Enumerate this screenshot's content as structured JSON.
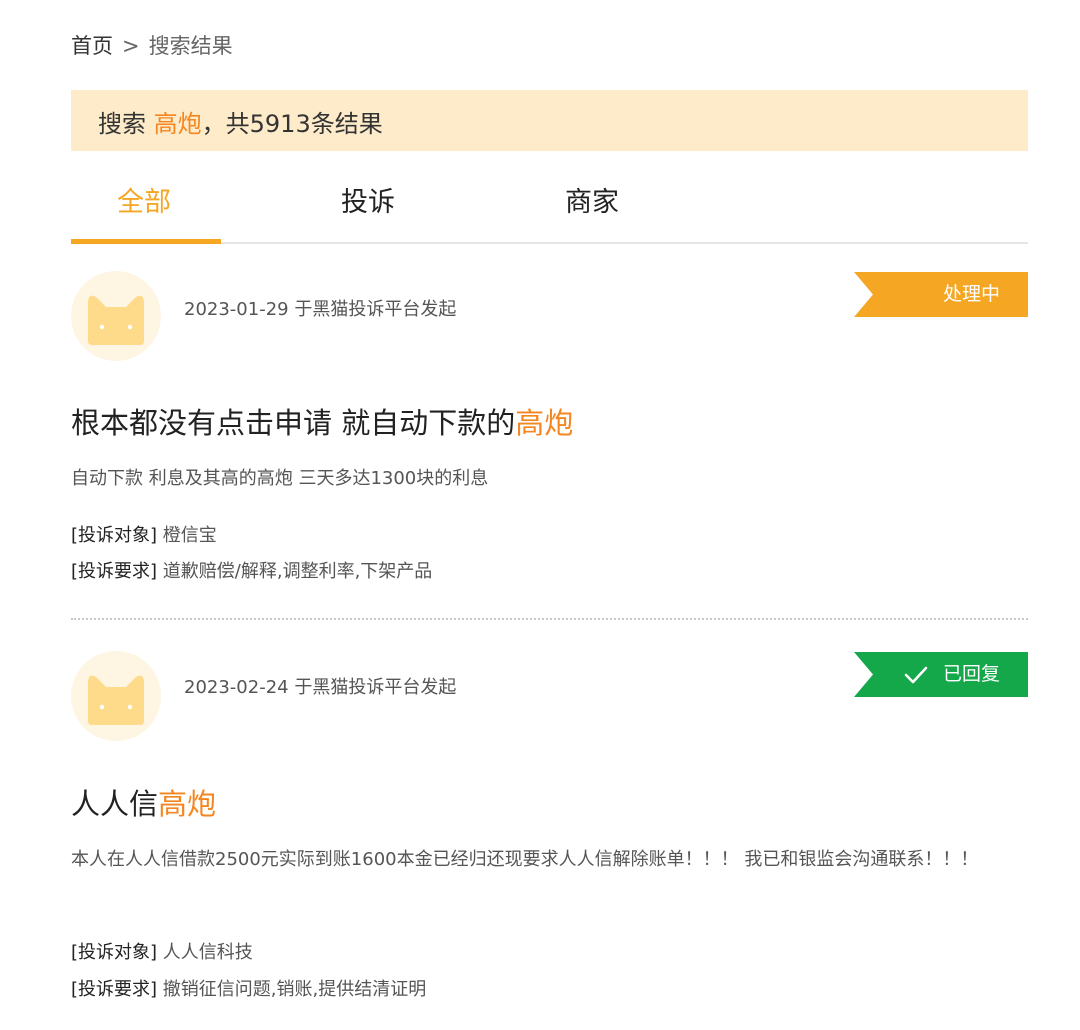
{
  "breadcrumb": {
    "home": "首页",
    "separator": ">",
    "current": "搜索结果"
  },
  "search": {
    "prefix": "搜索",
    "keyword": "高炮",
    "suffix": "，共5913条结果"
  },
  "tabs": [
    {
      "label": "全部",
      "active": true
    },
    {
      "label": "投诉",
      "active": false
    },
    {
      "label": "商家",
      "active": false
    }
  ],
  "results": [
    {
      "meta": "2023-01-29 于黑猫投诉平台发起",
      "status": {
        "label": "处理中",
        "color": "#f5a623",
        "icon": ""
      },
      "title_plain": "根本都没有点击申请 就自动下款的",
      "title_keyword": "高炮",
      "description": "自动下款 利息及其高的高炮 三天多达1300块的利息",
      "target_key": "[投诉对象]",
      "target": "橙信宝",
      "demand_key": "[投诉要求]",
      "demand": "道歉赔偿/解释,调整利率,下架产品"
    },
    {
      "meta": "2023-02-24 于黑猫投诉平台发起",
      "status": {
        "label": "已回复",
        "color": "#14a84a",
        "icon": "check-icon"
      },
      "title_plain": "人人信",
      "title_keyword": "高炮",
      "description": "本人在人人信借款2500元实际到账1600本金已经归还现要求人人信解除账单！！！ 我已和银监会沟通联系！！！",
      "target_key": "[投诉对象]",
      "target": "人人信科技",
      "demand_key": "[投诉要求]",
      "demand": "撤销征信问题,销账,提供结清证明"
    }
  ],
  "colors": {
    "accent": "#f5a623",
    "keyword": "#f5861f",
    "banner": "#fdebc9",
    "replied": "#14a84a"
  }
}
